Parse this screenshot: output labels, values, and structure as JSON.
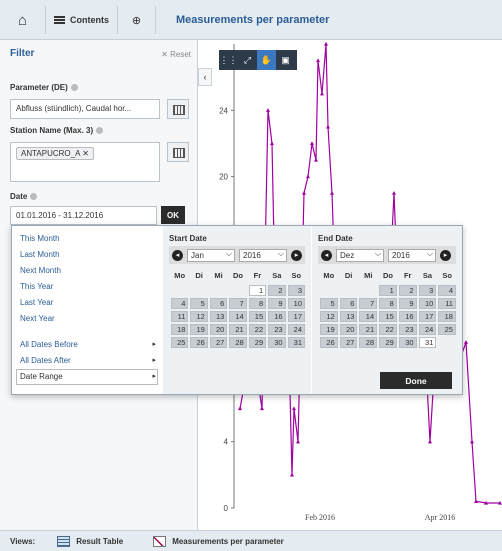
{
  "toolbar": {
    "contents_label": "Contents",
    "title": "Measurements per parameter"
  },
  "filter": {
    "heading": "Filter",
    "reset_label": "Reset",
    "parameter_label": "Parameter (DE)",
    "parameter_value": "Abfluss (stündlich), Caudal hor...",
    "station_label": "Station Name (Max. 3)",
    "station_tag": "ANTAPUCRO_A",
    "date_label": "Date",
    "date_value": "01.01.2016 - 31.12.2016",
    "ok_label": "OK"
  },
  "quick_ranges": {
    "items": [
      "This Month",
      "Last Month",
      "Next Month",
      "This Year",
      "Last Year",
      "Next Year"
    ],
    "submenus": [
      "All Dates Before",
      "All Dates After",
      "Date Range"
    ]
  },
  "calendar": {
    "weekday_headers": [
      "Mo",
      "Di",
      "Mi",
      "Do",
      "Fr",
      "Sa",
      "So"
    ],
    "start": {
      "title": "Start Date",
      "month": "Jan",
      "year": "2016",
      "leading_blanks": 4,
      "days_in_month": 31,
      "selected_day": 1
    },
    "end": {
      "title": "End Date",
      "month": "Dez",
      "year": "2016",
      "leading_blanks": 3,
      "days_in_month": 31,
      "selected_day": 31
    },
    "done_label": "Done"
  },
  "chart_data": {
    "type": "line",
    "y_ticks": [
      "0",
      "4",
      "20",
      "24"
    ],
    "x_ticks": [
      "Feb 2016",
      "Apr 2016"
    ],
    "series_color": "#a000a0",
    "x_domain": [
      "2015-12-20",
      "2016-05-01"
    ],
    "y_domain": [
      0,
      28
    ],
    "points": [
      [
        "2015-12-23",
        6
      ],
      [
        "2015-12-29",
        10
      ],
      [
        "2016-01-03",
        6
      ],
      [
        "2016-01-06",
        24
      ],
      [
        "2016-01-08",
        22
      ],
      [
        "2016-01-10",
        10
      ],
      [
        "2016-01-13",
        8
      ],
      [
        "2016-01-16",
        12
      ],
      [
        "2016-01-18",
        2
      ],
      [
        "2016-01-19",
        6
      ],
      [
        "2016-01-21",
        4
      ],
      [
        "2016-01-24",
        19
      ],
      [
        "2016-01-26",
        20
      ],
      [
        "2016-01-28",
        22
      ],
      [
        "2016-01-30",
        21
      ],
      [
        "2016-01-31",
        27
      ],
      [
        "2016-02-02",
        25
      ],
      [
        "2016-02-04",
        28
      ],
      [
        "2016-02-05",
        23
      ],
      [
        "2016-02-07",
        19
      ],
      [
        "2016-02-09",
        12
      ],
      [
        "2016-02-12",
        10
      ],
      [
        "2016-02-15",
        8
      ],
      [
        "2016-02-18",
        12
      ],
      [
        "2016-02-22",
        10
      ],
      [
        "2016-02-26",
        11
      ],
      [
        "2016-03-01",
        12
      ],
      [
        "2016-03-05",
        9
      ],
      [
        "2016-03-09",
        19
      ],
      [
        "2016-03-12",
        10
      ],
      [
        "2016-03-16",
        12
      ],
      [
        "2016-03-20",
        9
      ],
      [
        "2016-03-24",
        11
      ],
      [
        "2016-03-27",
        4
      ],
      [
        "2016-03-30",
        10
      ],
      [
        "2016-04-03",
        8
      ],
      [
        "2016-04-07",
        11
      ],
      [
        "2016-04-11",
        9
      ],
      [
        "2016-04-14",
        10
      ],
      [
        "2016-04-17",
        4
      ],
      [
        "2016-04-19",
        0.4
      ],
      [
        "2016-04-24",
        0.3
      ],
      [
        "2016-05-01",
        0.3
      ]
    ]
  },
  "views": {
    "label": "Views:",
    "result_table": "Result Table",
    "measurements": "Measurements per parameter"
  }
}
